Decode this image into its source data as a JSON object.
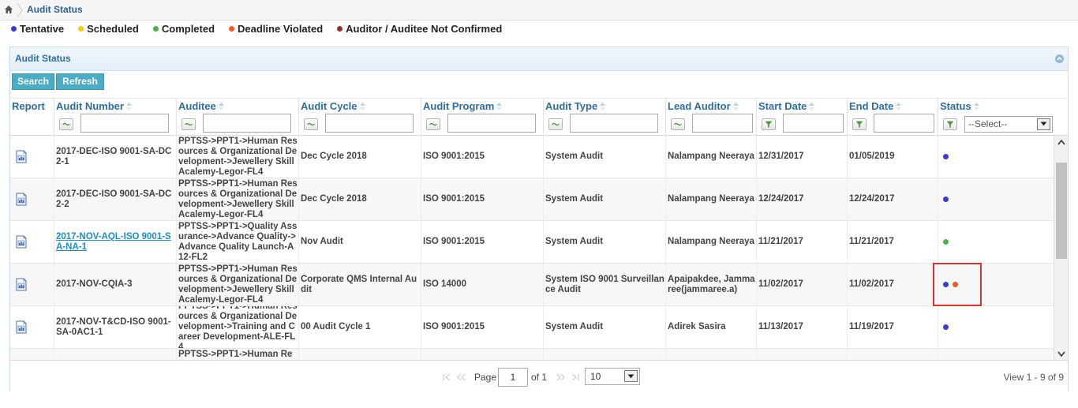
{
  "breadcrumb": {
    "title": "Audit Status"
  },
  "legend": [
    {
      "label": "Tentative",
      "color": "#3a3ad6"
    },
    {
      "label": "Scheduled",
      "color": "#f5d000"
    },
    {
      "label": "Completed",
      "color": "#4caf50"
    },
    {
      "label": "Deadline Violated",
      "color": "#f05a1e"
    },
    {
      "label": "Auditor / Auditee Not Confirmed",
      "color": "#9b2c2c"
    }
  ],
  "panel": {
    "title": "Audit Status"
  },
  "buttons": {
    "search": "Search",
    "refresh": "Refresh"
  },
  "columns": [
    "Report",
    "Audit Number",
    "Auditee",
    "Audit Cycle",
    "Audit Program",
    "Audit Type",
    "Lead Auditor",
    "Start Date",
    "End Date",
    "Status"
  ],
  "status_filter": {
    "selected": "--Select--"
  },
  "rows": [
    {
      "audit_number": "2017-DEC-ISO 9001-SA-DC2-1",
      "link": false,
      "auditee": "PPTSS->PPT1->Human Resources & Organizational Development->Jewellery Skill Acalemy-Legor-FL4",
      "audit_cycle": "Dec Cycle 2018",
      "audit_program": "ISO 9001:2015",
      "audit_type": "System Audit",
      "lead_auditor": "Nalampang Neeraya",
      "start_date": "12/31/2017",
      "end_date": "01/05/2019",
      "status": [
        "#3a3ad6"
      ]
    },
    {
      "audit_number": "2017-DEC-ISO 9001-SA-DC2-2",
      "link": false,
      "auditee": "PPTSS->PPT1->Human Resources & Organizational Development->Jewellery Skill Acalemy-Legor-FL4",
      "audit_cycle": "Dec Cycle 2018",
      "audit_program": "ISO 9001:2015",
      "audit_type": "System Audit",
      "lead_auditor": "Nalampang Neeraya",
      "start_date": "12/24/2017",
      "end_date": "12/24/2017",
      "status": [
        "#3a3ad6"
      ]
    },
    {
      "audit_number": "2017-NOV-AQL-ISO 9001-SA-NA-1",
      "link": true,
      "auditee": "PPTSS->PPT1->Quality Assurance->Advance Quality->Advance Quality Launch-A12-FL2",
      "audit_cycle": "Nov Audit",
      "audit_program": "ISO 9001:2015",
      "audit_type": "System Audit",
      "lead_auditor": "Nalampang Neeraya",
      "start_date": "11/21/2017",
      "end_date": "11/21/2017",
      "status": [
        "#4caf50"
      ]
    },
    {
      "audit_number": "2017-NOV-CQIA-3",
      "link": false,
      "auditee": "PPTSS->PPT1->Human Resources & Organizational Development->Jewellery Skill Acalemy-Legor-FL4",
      "audit_cycle": "Corporate QMS Internal Audit",
      "audit_program": "ISO 14000",
      "audit_type": "System ISO 9001 Surveillance Audit",
      "lead_auditor": "Apaipakdee, Jammaree(jammaree.a)",
      "start_date": "11/02/2017",
      "end_date": "11/02/2017",
      "status": [
        "#3a3ad6",
        "#f05a1e"
      ]
    },
    {
      "audit_number": "2017-NOV-T&CD-ISO 9001-SA-0AC1-1",
      "link": false,
      "auditee": "PPTSS->PPT1->Human Resources & Organizational Development->Training and Career Development-ALE-FL4",
      "audit_cycle": "00 Audit Cycle 1",
      "audit_program": "ISO 9001:2015",
      "audit_type": "System Audit",
      "lead_auditor": "Adirek Sasira",
      "start_date": "11/13/2017",
      "end_date": "11/19/2017",
      "status": [
        "#3a3ad6"
      ]
    },
    {
      "audit_number": "",
      "link": false,
      "auditee": "PPTSS->PPT1->Human Re",
      "audit_cycle": "",
      "audit_program": "",
      "audit_type": "",
      "lead_auditor": "",
      "start_date": "",
      "end_date": "",
      "status": []
    }
  ],
  "pager": {
    "page_label": "Page",
    "page_value": "1",
    "of_label": "of 1",
    "page_size": "10",
    "view_text": "View 1 - 9 of 9"
  }
}
